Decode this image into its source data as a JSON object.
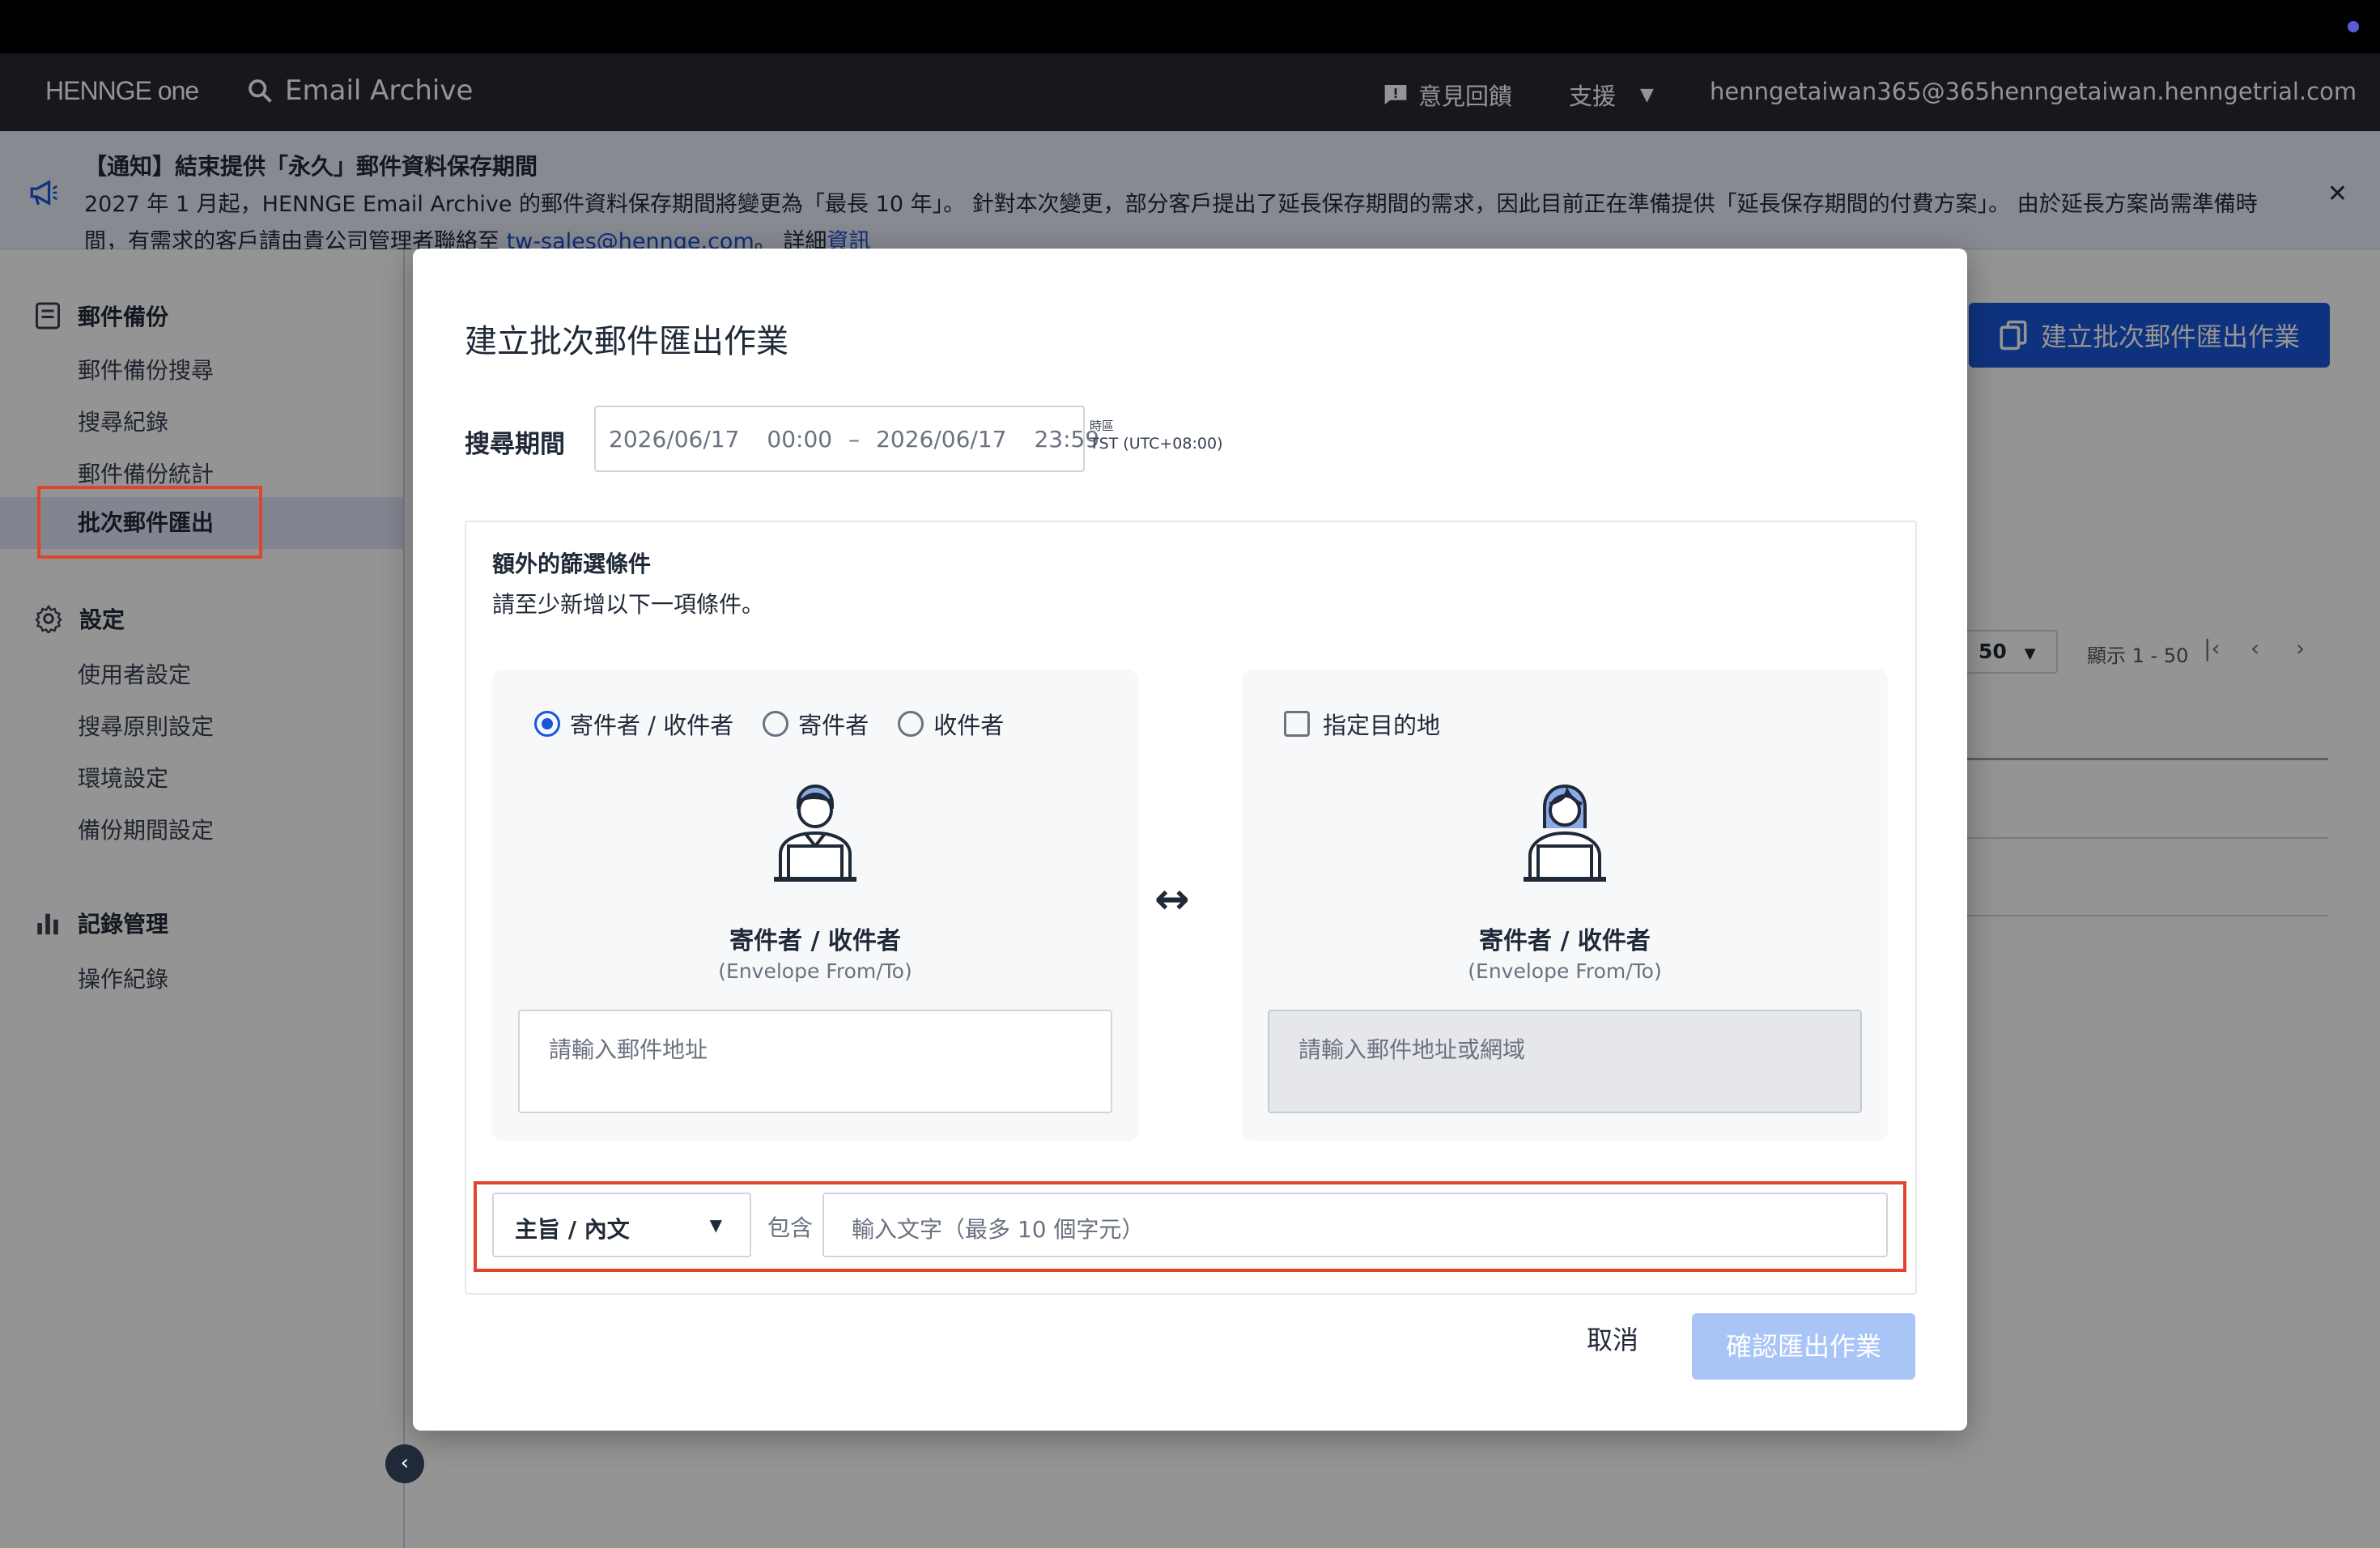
{
  "header": {
    "logo": "HENNGE one",
    "product": "Email Archive",
    "feedback": "意見回饋",
    "support": "支援",
    "account": "henngetaiwan365@365henngetaiwan.henngetrial.com"
  },
  "notice": {
    "title": "【通知】結束提供「永久」郵件資料保存期間",
    "text_prefix": "2027 年 1 月起，HENNGE Email Archive 的郵件資料保存期間將變更為「最長 10 年」。 針對本次變更，部分客戶提出了延長保存期間的需求，因此目前正在準備提供「延長保存期間的付費方案」。 由於延長方案尚需準備時間，有需求的客戶請由貴公司管理者聯絡至",
    "email": "tw-sales@hennge.com",
    "text_mid": "。 詳細",
    "link": "資訊"
  },
  "sidebar": {
    "section1": "郵件備份",
    "items1": [
      "郵件備份搜尋",
      "搜尋紀錄",
      "郵件備份統計",
      "批次郵件匯出"
    ],
    "section2": "設定",
    "items2": [
      "使用者設定",
      "搜尋原則設定",
      "環境設定",
      "備份期間設定"
    ],
    "section3": "記錄管理",
    "items3": [
      "操作紀錄"
    ]
  },
  "background": {
    "create_button": "建立批次郵件匯出作業",
    "page_size": "50",
    "showing": "顯示 1 - 50"
  },
  "modal": {
    "title": "建立批次郵件匯出作業",
    "period_label": "搜尋期間",
    "start_date": "2026/06/17",
    "start_time": "00:00",
    "dash": "–",
    "end_date": "2026/06/17",
    "end_time": "23:59",
    "tz_label": "時區",
    "tz_value": "TST (UTC+08:00)",
    "filter_title": "額外的篩選條件",
    "filter_hint": "請至少新增以下一項條件。",
    "left": {
      "options": [
        "寄件者 / 收件者",
        "寄件者",
        "收件者"
      ],
      "name": "寄件者 / 收件者",
      "sub": "(Envelope From/To)",
      "placeholder": "請輸入郵件地址"
    },
    "arrow": "↔",
    "right": {
      "checkbox": "指定目的地",
      "name": "寄件者 / 收件者",
      "sub": "(Envelope From/To)",
      "placeholder": "請輸入郵件地址或網域"
    },
    "keyword": {
      "field": "主旨 / 內文",
      "op": "包含",
      "placeholder": "輸入文字（最多 10 個字元）"
    },
    "cancel": "取消",
    "confirm": "確認匯出作業"
  }
}
